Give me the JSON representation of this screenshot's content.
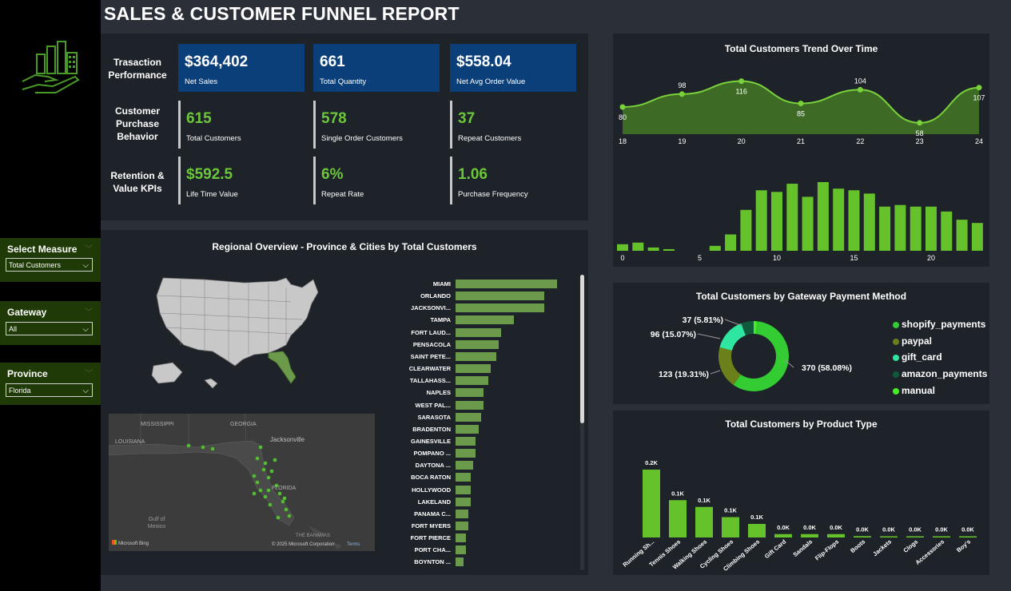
{
  "title": "SALES & CUSTOMER FUNNEL REPORT",
  "slicers": [
    {
      "label": "Select Measure",
      "value": "Total Customers"
    },
    {
      "label": "Gateway",
      "value": "All"
    },
    {
      "label": "Province",
      "value": "Florida"
    }
  ],
  "kpi_rows": [
    {
      "label": "Trasaction Performance",
      "cards": [
        {
          "value": "$364,402",
          "sub": "Net Sales"
        },
        {
          "value": "661",
          "sub": "Total Quantity"
        },
        {
          "value": "$558.04",
          "sub": "Net Avg Order Value"
        }
      ]
    },
    {
      "label": "Customer Purchase Behavior",
      "cards": [
        {
          "value": "615",
          "sub": "Total Customers"
        },
        {
          "value": "578",
          "sub": "Single Order Customers"
        },
        {
          "value": "37",
          "sub": "Repeat Customers"
        }
      ]
    },
    {
      "label": "Retention & Value KPIs",
      "cards": [
        {
          "value": "$592.5",
          "sub": "Life Time Value"
        },
        {
          "value": "6%",
          "sub": "Repeat Rate"
        },
        {
          "value": "1.06",
          "sub": "Purchase Frequency"
        }
      ]
    }
  ],
  "regional": {
    "title": "Regional Overview - Province & Cities by Total Customers",
    "map_credit": "Microsoft Bing",
    "map_copyright": "© 2025 Microsoft Corporation",
    "map_terms": "Terms",
    "map_labels": [
      "MISSISSIPPI",
      "GEORGIA",
      "LOUISIANA",
      "Jacksonville",
      "FLORIDA",
      "Gulf of Mexico",
      "THE BAHAMAS"
    ]
  },
  "colors": {
    "accent": "#6cc63a",
    "blue_card": "#0b3f7a",
    "city_bar": "#6a9a4a"
  },
  "chart_data": [
    {
      "type": "bar",
      "title": "",
      "orientation": "horizontal",
      "categories": [
        "MIAMI",
        "ORLANDO",
        "JACKSONVI...",
        "TAMPA",
        "FORT LAUD...",
        "PENSACOLA",
        "SAINT PETE...",
        "CLEARWATER",
        "TALLAHASS...",
        "NAPLES",
        "WEST PAL...",
        "SARASOTA",
        "BRADENTON",
        "GAINESVILLE",
        "POMPANO ...",
        "DAYTONA ...",
        "BOCA RATON",
        "HOLLYWOOD",
        "LAKELAND",
        "PANAMA C...",
        "FORT MYERS",
        "FORT PIERCE",
        "PORT CHA...",
        "BOYNTON ..."
      ],
      "values": [
        40,
        35,
        35,
        23,
        18,
        17,
        16,
        14,
        13,
        11,
        11,
        10,
        9,
        8,
        8,
        7,
        6,
        6,
        6,
        5,
        5,
        4,
        4,
        3
      ]
    },
    {
      "type": "area",
      "title": "Total Customers Trend Over Time",
      "x": [
        18,
        19,
        20,
        21,
        22,
        23,
        24
      ],
      "values": [
        80,
        98,
        116,
        85,
        104,
        58,
        107
      ]
    },
    {
      "type": "bar",
      "title": "",
      "x": [
        0,
        1,
        2,
        3,
        4,
        5,
        6,
        7,
        8,
        9,
        10,
        11,
        12,
        13,
        14,
        15,
        16,
        17,
        18,
        19,
        20,
        21,
        22,
        23
      ],
      "values": [
        4,
        5,
        2,
        1,
        0,
        0,
        3,
        10,
        25,
        37,
        36,
        41,
        33,
        42,
        38,
        37,
        35,
        27,
        28,
        27,
        27,
        24,
        19,
        17
      ],
      "xticks": [
        0,
        5,
        10,
        15,
        20
      ]
    },
    {
      "type": "pie",
      "title": "Total Customers by Gateway Payment Method",
      "categories": [
        "shopify_payments",
        "paypal",
        "gift_card",
        "amazon_payments",
        "manual"
      ],
      "values": [
        370,
        123,
        96,
        37,
        10
      ],
      "data_labels": [
        "370 (58.08%)",
        "123 (19.31%)",
        "96 (15.07%)",
        "37 (5.81%)"
      ],
      "colors": [
        "#33cc33",
        "#6b7f1a",
        "#2ee6a0",
        "#0f5a3a",
        "#44ee22"
      ]
    },
    {
      "type": "bar",
      "title": "Total Customers by Product Type",
      "categories": [
        "Running Sh...",
        "Tennis Shoes",
        "Walking Shoes",
        "Cycling Shoes",
        "Climbing Shoes",
        "Gift Card",
        "Sandals",
        "Flip-Flops",
        "Boots",
        "Jackets",
        "Clogs",
        "Accessories",
        "Boy's"
      ],
      "values": [
        0.2,
        0.11,
        0.09,
        0.06,
        0.04,
        0.01,
        0.01,
        0.01,
        0.004,
        0.003,
        0.002,
        0.002,
        0.001
      ],
      "data_labels": [
        "0.2K",
        "0.1K",
        "0.1K",
        "0.1K",
        "0.1K",
        "0.0K",
        "0.0K",
        "0.0K",
        "0.0K",
        "0.0K",
        "0.0K",
        "0.0K",
        "0.0K"
      ]
    }
  ]
}
